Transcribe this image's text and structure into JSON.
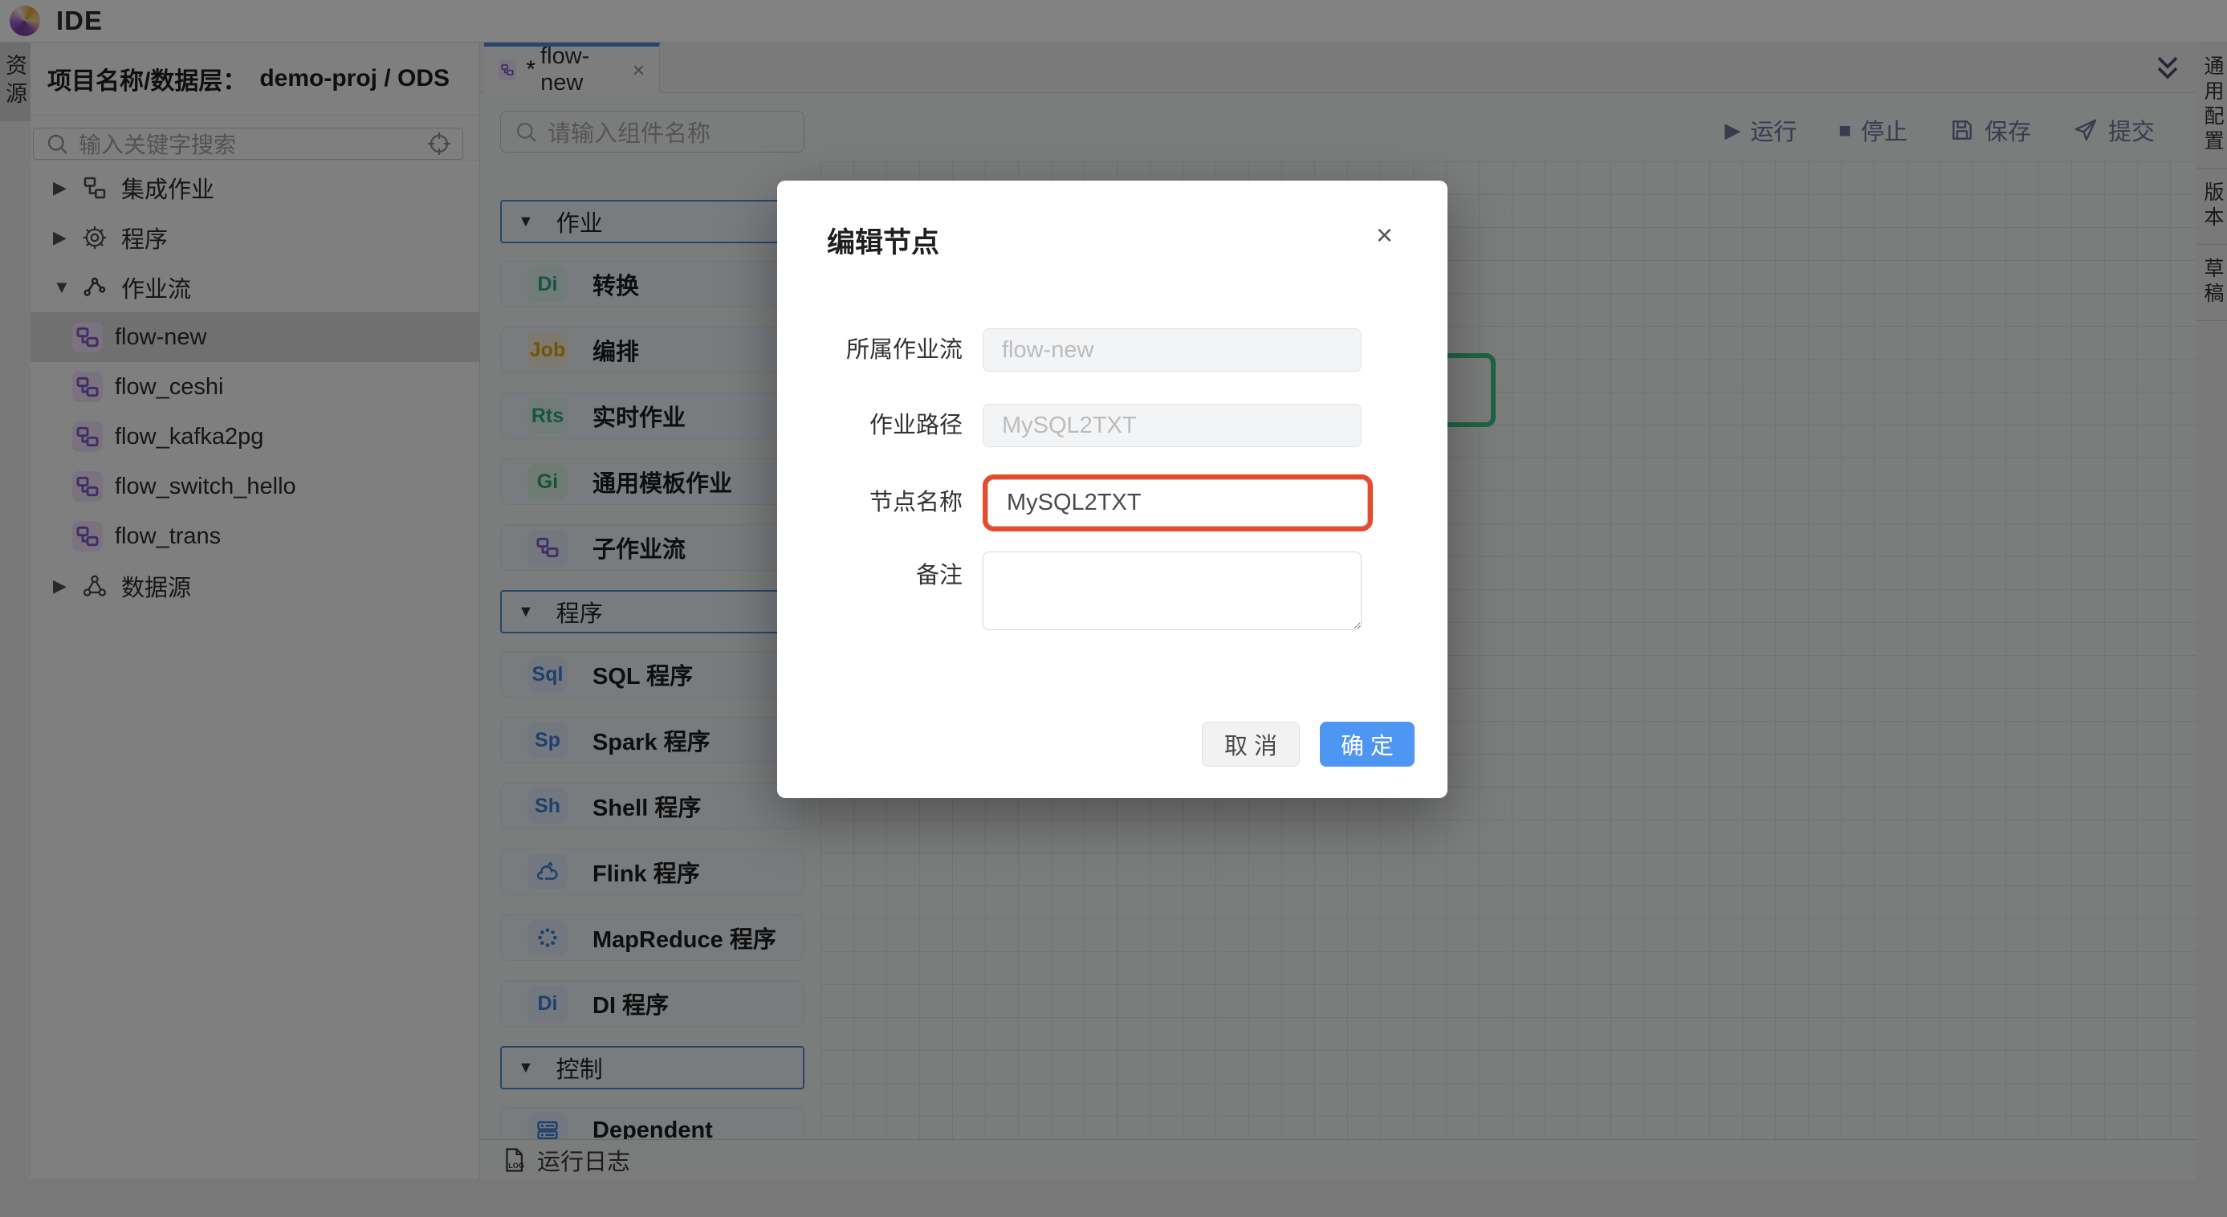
{
  "app": {
    "title": "IDE"
  },
  "left_rail": {
    "tabs": [
      {
        "label": "资源",
        "active": true
      }
    ]
  },
  "explorer": {
    "header_label": "项目名称/数据层：",
    "header_value": "demo-proj / ODS",
    "search_placeholder": "输入关键字搜索",
    "tree": [
      {
        "label": "集成作业",
        "icon": "integration-icon",
        "arrow": "right",
        "level": 0,
        "selected": false
      },
      {
        "label": "程序",
        "icon": "gear-icon",
        "arrow": "right",
        "level": 0,
        "selected": false
      },
      {
        "label": "作业流",
        "icon": "workflow-branch-icon",
        "arrow": "down",
        "level": 0,
        "selected": false
      },
      {
        "label": "flow-new",
        "icon": "flow-icon",
        "level": 1,
        "selected": true
      },
      {
        "label": "flow_ceshi",
        "icon": "flow-icon",
        "level": 1,
        "selected": false
      },
      {
        "label": "flow_kafka2pg",
        "icon": "flow-icon",
        "level": 1,
        "selected": false
      },
      {
        "label": "flow_switch_hello",
        "icon": "flow-icon",
        "level": 1,
        "selected": false
      },
      {
        "label": "flow_trans",
        "icon": "flow-icon",
        "level": 1,
        "selected": false
      },
      {
        "label": "数据源",
        "icon": "datasource-icon",
        "arrow": "right",
        "level": 0,
        "selected": false
      }
    ]
  },
  "editor": {
    "tab": {
      "dirty_marker": "*",
      "name": "flow-new",
      "close": "×",
      "icon": "flow-icon"
    },
    "component_search_placeholder": "请输入组件名称",
    "toolbar": [
      {
        "label": "运行",
        "icon": "run-icon"
      },
      {
        "label": "停止",
        "icon": "stop-icon"
      },
      {
        "label": "保存",
        "icon": "save-icon"
      },
      {
        "label": "提交",
        "icon": "submit-icon"
      }
    ],
    "palette": [
      {
        "type": "section",
        "label": "作业",
        "arrow": "▼"
      },
      {
        "type": "item",
        "label": "转换",
        "badge": "Di",
        "badge_style": "teal"
      },
      {
        "type": "item",
        "label": "编排",
        "badge": "Job",
        "badge_style": "amber"
      },
      {
        "type": "item",
        "label": "实时作业",
        "badge": "Rts",
        "badge_style": "teal"
      },
      {
        "type": "item",
        "label": "通用模板作业",
        "badge": "Gi",
        "badge_style": "green"
      },
      {
        "type": "item",
        "label": "子作业流",
        "icon": "subflow-icon"
      },
      {
        "type": "section",
        "label": "程序",
        "arrow": "▼"
      },
      {
        "type": "item",
        "label": "SQL 程序",
        "badge": "Sql",
        "badge_style": "blue"
      },
      {
        "type": "item",
        "label": "Spark 程序",
        "badge": "Sp",
        "badge_style": "blue"
      },
      {
        "type": "item",
        "label": "Shell 程序",
        "badge": "Sh",
        "badge_style": "blue"
      },
      {
        "type": "item",
        "label": "Flink 程序",
        "icon": "flink-squirrel-icon"
      },
      {
        "type": "item",
        "label": "MapReduce 程序",
        "icon": "mapreduce-icon"
      },
      {
        "type": "item",
        "label": "DI 程序",
        "badge": "Di",
        "badge_style": "blue"
      },
      {
        "type": "section",
        "label": "控制",
        "arrow": "▼"
      },
      {
        "type": "item",
        "label": "Dependent",
        "icon": "dependent-icon"
      }
    ],
    "bottom_bar": {
      "label": "运行日志",
      "icon": "log-icon"
    }
  },
  "right_rail": {
    "tabs": [
      {
        "label": "通用配置"
      },
      {
        "label": "版本"
      },
      {
        "label": "草稿"
      }
    ]
  },
  "canvas": {
    "node_border_color": "#3cc487"
  },
  "modal": {
    "title": "编辑节点",
    "close": "×",
    "fields": [
      {
        "label": "所属作业流",
        "value": "flow-new",
        "state": "disabled"
      },
      {
        "label": "作业路径",
        "value": "MySQL2TXT",
        "state": "disabled"
      },
      {
        "label": "节点名称",
        "value": "MySQL2TXT",
        "state": "focused-error"
      },
      {
        "label": "备注",
        "value": "",
        "state": "textarea"
      }
    ],
    "cancel_label": "取 消",
    "ok_label": "确 定",
    "colors": {
      "focus_ring": "#e84a2d",
      "primary": "#4d96f2"
    }
  }
}
